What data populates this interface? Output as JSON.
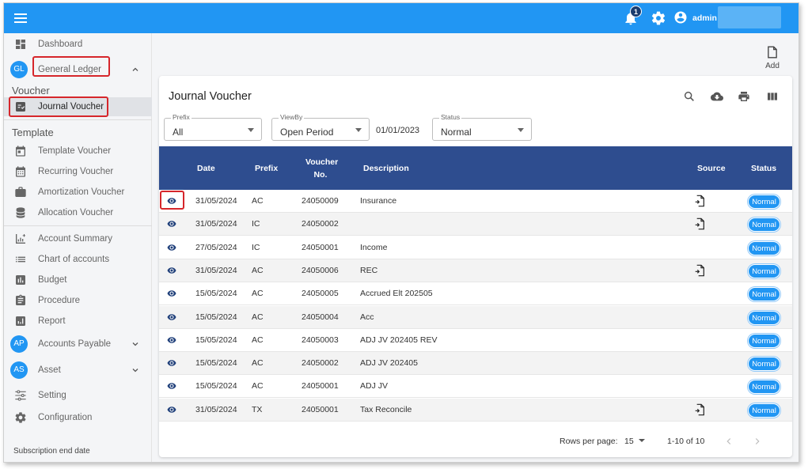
{
  "topbar": {
    "notification_count": "1",
    "user_name": "admin"
  },
  "sidebar": {
    "dashboard": "Dashboard",
    "general_ledger": {
      "avatar": "GL",
      "label": "General Ledger"
    },
    "voucher_section": "Voucher",
    "journal_voucher": "Journal Voucher",
    "template_section": "Template",
    "template_items": [
      "Template Voucher",
      "Recurring Voucher",
      "Amortization Voucher",
      "Allocation Voucher"
    ],
    "other_items": [
      "Account Summary",
      "Chart of accounts",
      "Budget",
      "Procedure",
      "Report"
    ],
    "accounts_payable": {
      "avatar": "AP",
      "label": "Accounts Payable"
    },
    "asset": {
      "avatar": "AS",
      "label": "Asset"
    },
    "setting": "Setting",
    "configuration": "Configuration",
    "subscription_end": "Subscription end date"
  },
  "add_button": {
    "label": "Add"
  },
  "card": {
    "title": "Journal Voucher",
    "filters": {
      "prefix": {
        "label": "Prefix",
        "value": "All"
      },
      "viewby": {
        "label": "ViewBy",
        "value": "Open Period"
      },
      "date": "01/01/2023",
      "status": {
        "label": "Status",
        "value": "Normal"
      }
    },
    "columns": {
      "date": "Date",
      "prefix": "Prefix",
      "voucher_line1": "Voucher",
      "voucher_line2": "No.",
      "description": "Description",
      "source": "Source",
      "status": "Status"
    },
    "rows": [
      {
        "date": "31/05/2024",
        "prefix": "AC",
        "voucher": "24050009",
        "description": "Insurance",
        "source": true,
        "status": "Normal"
      },
      {
        "date": "31/05/2024",
        "prefix": "IC",
        "voucher": "24050002",
        "description": "",
        "source": true,
        "status": "Normal"
      },
      {
        "date": "27/05/2024",
        "prefix": "IC",
        "voucher": "24050001",
        "description": "Income",
        "source": false,
        "status": "Normal"
      },
      {
        "date": "31/05/2024",
        "prefix": "AC",
        "voucher": "24050006",
        "description": "REC",
        "source": true,
        "status": "Normal"
      },
      {
        "date": "15/05/2024",
        "prefix": "AC",
        "voucher": "24050005",
        "description": "Accrued Elt 202505",
        "source": false,
        "status": "Normal"
      },
      {
        "date": "15/05/2024",
        "prefix": "AC",
        "voucher": "24050004",
        "description": "Acc",
        "source": false,
        "status": "Normal"
      },
      {
        "date": "15/05/2024",
        "prefix": "AC",
        "voucher": "24050003",
        "description": "ADJ JV 202405 REV",
        "source": false,
        "status": "Normal"
      },
      {
        "date": "15/05/2024",
        "prefix": "AC",
        "voucher": "24050002",
        "description": "ADJ JV 202405",
        "source": false,
        "status": "Normal"
      },
      {
        "date": "15/05/2024",
        "prefix": "AC",
        "voucher": "24050001",
        "description": "ADJ JV",
        "source": false,
        "status": "Normal"
      },
      {
        "date": "31/05/2024",
        "prefix": "TX",
        "voucher": "24050001",
        "description": "Tax Reconcile",
        "source": true,
        "status": "Normal"
      }
    ],
    "pagination": {
      "rows_per_page_label": "Rows per page:",
      "rows_per_page": "15",
      "range": "1-10 of 10"
    }
  },
  "colors": {
    "topbar": "#2196f3",
    "table_header": "#2e4d8f",
    "status_pill": "#2196f3",
    "highlight": "#d6262b"
  }
}
